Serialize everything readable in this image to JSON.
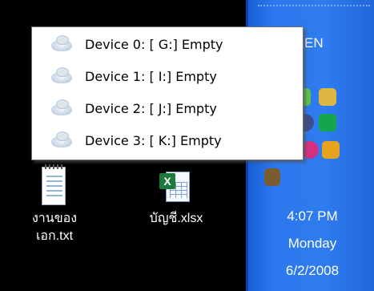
{
  "context_menu": {
    "items": [
      {
        "label": "Device 0: [ G:] Empty"
      },
      {
        "label": "Device 1: [ I:] Empty"
      },
      {
        "label": "Device 2: [ J:] Empty"
      },
      {
        "label": "Device 3: [ K:] Empty"
      }
    ]
  },
  "desktop": {
    "icons": [
      {
        "name_line1": "งานของ",
        "name_line2": "เอก.txt"
      },
      {
        "name_line1": "บัญชี.xlsx",
        "name_line2": ""
      }
    ]
  },
  "taskbar": {
    "language": "EN",
    "time": "4:07 PM",
    "day": "Monday",
    "date": "6/2/2008"
  }
}
